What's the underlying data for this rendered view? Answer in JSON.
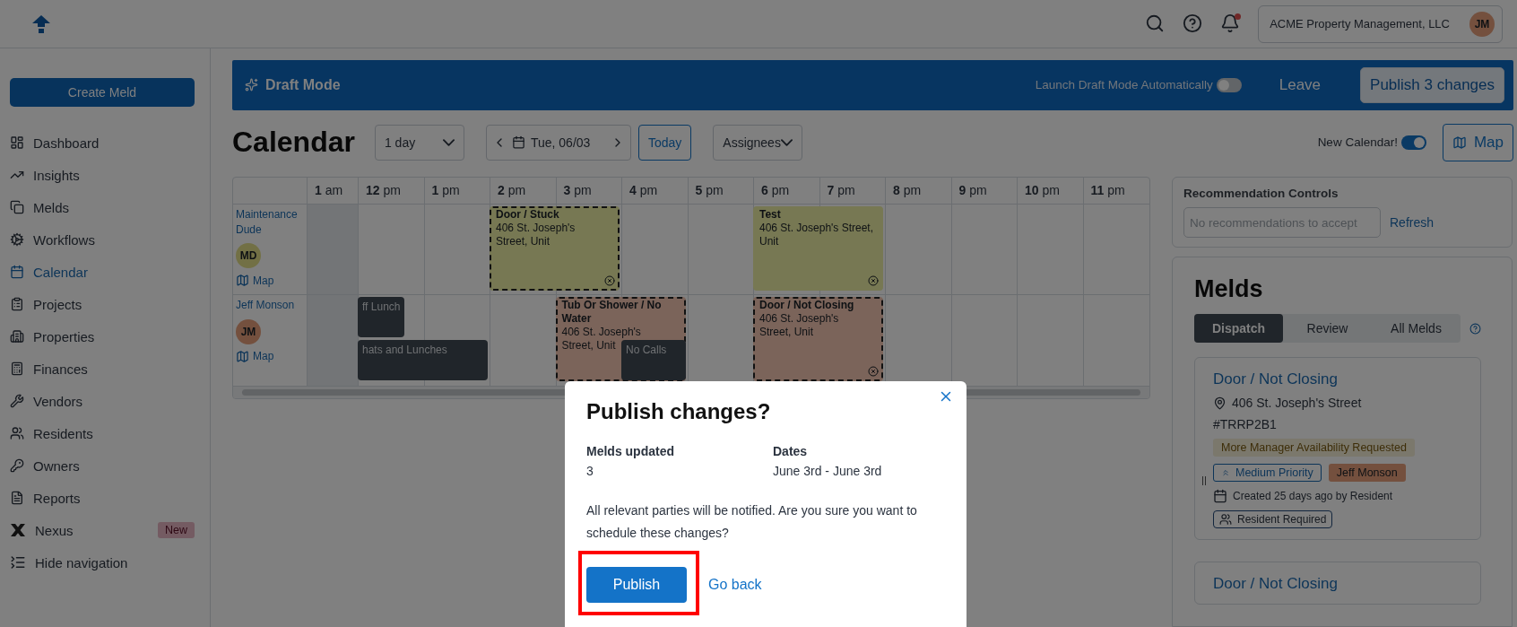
{
  "topbar": {
    "account": "ACME Property Management, LLC",
    "initials": "JM",
    "notification_dot": true
  },
  "sidebar": {
    "create_button": "Create Meld",
    "items": [
      {
        "label": "Dashboard",
        "selected": false
      },
      {
        "label": "Insights",
        "selected": false
      },
      {
        "label": "Melds",
        "selected": false
      },
      {
        "label": "Workflows",
        "selected": false
      },
      {
        "label": "Calendar",
        "selected": true
      },
      {
        "label": "Projects",
        "selected": false
      },
      {
        "label": "Properties",
        "selected": false
      },
      {
        "label": "Finances",
        "selected": false
      },
      {
        "label": "Vendors",
        "selected": false
      },
      {
        "label": "Residents",
        "selected": false
      },
      {
        "label": "Owners",
        "selected": false
      },
      {
        "label": "Reports",
        "selected": false
      },
      {
        "label": "Nexus",
        "selected": false,
        "badge": "New"
      }
    ],
    "hide_label": "Hide navigation"
  },
  "draft_bar": {
    "title": "Draft Mode",
    "auto_label": "Launch Draft Mode Automatically",
    "auto_on": false,
    "leave": "Leave",
    "publish": "Publish 3 changes"
  },
  "calendar_header": {
    "title": "Calendar",
    "range": "1 day",
    "date": "Tue, 06/03",
    "today": "Today",
    "assignees": "Assignees",
    "new_calendar_label": "New Calendar!",
    "new_calendar_on": true,
    "map": "Map"
  },
  "schedule": {
    "hours": [
      "**1** am",
      "**12** pm",
      "**1** pm",
      "**2** pm",
      "**3** pm",
      "**4** pm",
      "**5** pm",
      "**6** pm",
      "**7** pm",
      "**8** pm",
      "**9** pm",
      "**10** pm",
      "**11** pm"
    ],
    "rows": [
      {
        "name": "Maintenance Dude",
        "initials": "MD",
        "color": "#727045",
        "map": "Map",
        "events": [
          {
            "kind": "meld",
            "title": "Door / Stuck",
            "address": [
              "406 St. Joseph's",
              "Street, Unit"
            ],
            "color": "#777853",
            "draft": true,
            "close_icon": true
          },
          {
            "kind": "meld",
            "title": "Test",
            "address": [
              "406 St. Joseph's Street,",
              "Unit"
            ],
            "color": "#777853",
            "draft": false,
            "close_icon": true
          }
        ]
      },
      {
        "name": "Jeff Monson",
        "initials": "JM",
        "color": "#74503e",
        "map": "Map",
        "events": [
          {
            "kind": "block",
            "title": "ff Lunch"
          },
          {
            "kind": "block",
            "title": "hats and Lunches"
          },
          {
            "kind": "meld",
            "title": "Tub Or Shower / No Water",
            "address": [
              "406 St. Joseph's",
              "Street, Unit"
            ],
            "color": "#7b645a",
            "draft": true,
            "close_icon": false
          },
          {
            "kind": "block",
            "title": "No Calls"
          },
          {
            "kind": "meld",
            "title": "Door / Not Closing",
            "address": [
              "406 St. Joseph's",
              "Street, Unit"
            ],
            "color": "#7b645a",
            "draft": true,
            "close_icon": true
          }
        ]
      }
    ]
  },
  "recommendations": {
    "title": "Recommendation Controls",
    "placeholder": "No recommendations to accept",
    "refresh": "Refresh"
  },
  "melds_panel": {
    "title": "Melds",
    "tabs": [
      {
        "label": "Dispatch",
        "selected": true
      },
      {
        "label": "Review",
        "selected": false
      },
      {
        "label": "All Melds",
        "selected": false
      }
    ],
    "cards": [
      {
        "title": "Door / Not Closing",
        "address": "406 St. Joseph's Street",
        "ref": "#TRRP2B1",
        "status": "More Manager Availability Requested",
        "priority": "Medium Priority",
        "assignee": "Jeff Monson",
        "created": "Created 25 days ago by Resident",
        "requirement": "Resident Required"
      },
      {
        "title": "Door / Not Closing"
      }
    ]
  },
  "dialog": {
    "title": "Publish changes?",
    "fields": [
      {
        "label": "Melds updated",
        "value": "3"
      },
      {
        "label": "Dates",
        "value": "June 3rd - June 3rd"
      }
    ],
    "message": "All relevant parties will be notified. Are you sure you want to schedule these changes?",
    "confirm": "Publish",
    "confirm_highlighted": true,
    "cancel": "Go back"
  }
}
